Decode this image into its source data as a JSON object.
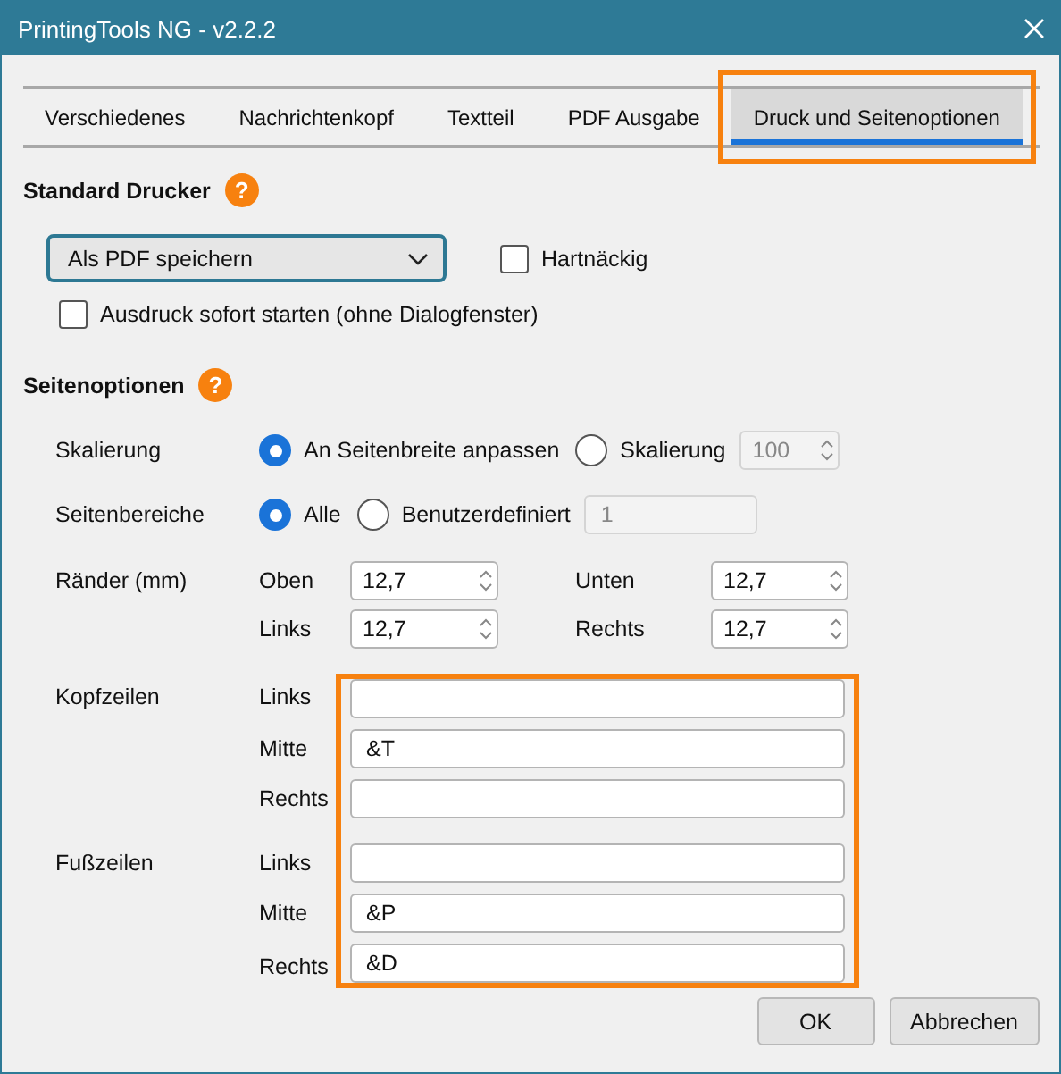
{
  "window": {
    "title": "PrintingTools NG - v2.2.2"
  },
  "tabs": [
    {
      "label": "Verschiedenes",
      "selected": false,
      "highlighted": false
    },
    {
      "label": "Nachrichtenkopf",
      "selected": false,
      "highlighted": false
    },
    {
      "label": "Textteil",
      "selected": false,
      "highlighted": false
    },
    {
      "label": "PDF Ausgabe",
      "selected": false,
      "highlighted": false
    },
    {
      "label": "Druck und Seitenoptionen",
      "selected": true,
      "highlighted": true
    }
  ],
  "printer": {
    "title": "Standard Drucker",
    "help": "?",
    "value": "Als PDF speichern",
    "checkboxes": [
      {
        "label": "Hartnäckig",
        "checked": false
      },
      {
        "label": "Ausdruck sofort starten (ohne Dialogfenster)",
        "checked": false
      }
    ]
  },
  "page_options": {
    "title": "Seitenoptionen",
    "help": "?",
    "scaling": {
      "label": "Skalierung",
      "options": [
        {
          "label": "An Seitenbreite anpassen",
          "selected": true
        },
        {
          "label": "Skalierung",
          "selected": false
        }
      ],
      "value": "100",
      "disabled": true
    },
    "ranges": {
      "label": "Seitenbereiche",
      "options": [
        {
          "label": "Alle",
          "selected": true
        },
        {
          "label": "Benutzerdefiniert",
          "selected": false
        }
      ],
      "value": "1",
      "disabled": true
    },
    "margins": {
      "label": "Ränder (mm)",
      "fields": [
        {
          "label": "Oben",
          "value": "12,7"
        },
        {
          "label": "Unten",
          "value": "12,7"
        },
        {
          "label": "Links",
          "value": "12,7"
        },
        {
          "label": "Rechts",
          "value": "12,7"
        }
      ]
    },
    "headers_footers": {
      "highlighted": true,
      "groups": [
        {
          "label": "Kopfzeilen",
          "fields": [
            {
              "label": "Links"
            },
            {
              "label": "Mitte",
              "value": "&T"
            },
            {
              "label": "Rechts"
            }
          ]
        },
        {
          "label": "Fußzeilen",
          "fields": [
            {
              "label": "Links"
            },
            {
              "label": "Mitte",
              "value": "&P"
            },
            {
              "label": "Rechts",
              "value": "&D"
            }
          ]
        }
      ]
    }
  },
  "buttons": [
    {
      "label": "OK"
    },
    {
      "label": "Abbrechen"
    }
  ]
}
